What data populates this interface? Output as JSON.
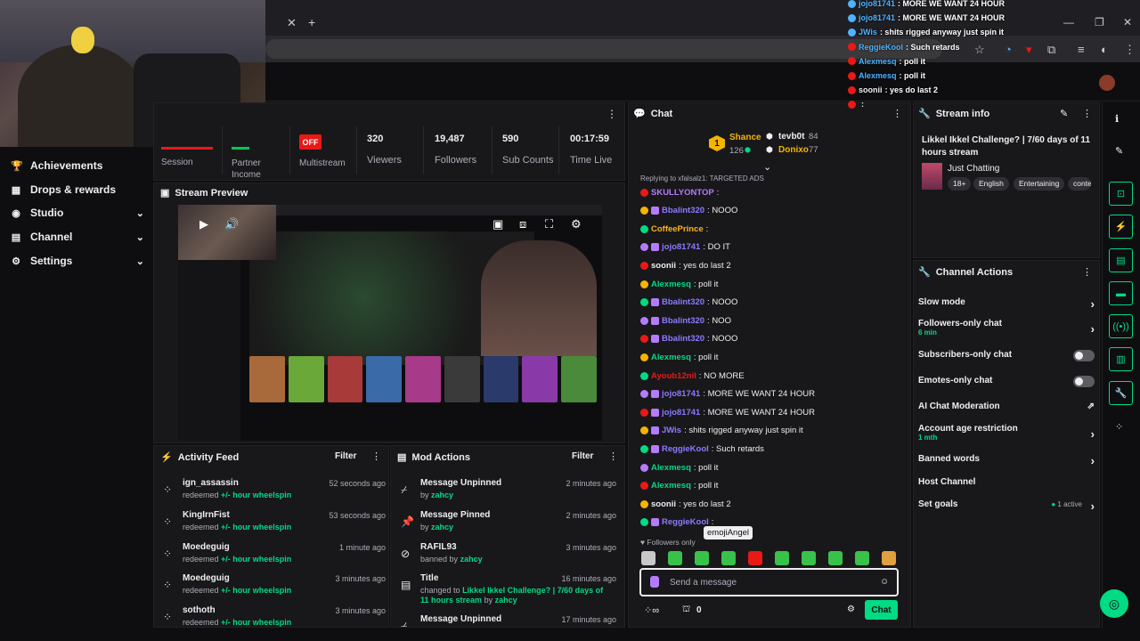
{
  "browser": {
    "tab_close": "✕",
    "tab_new": "+",
    "window_controls": [
      "—",
      "❐",
      "✕"
    ]
  },
  "nav": {
    "items": [
      {
        "label": "Achievements",
        "icon": "trophy-icon",
        "glyph": "🏆",
        "chevron": false
      },
      {
        "label": "Drops & rewards",
        "icon": "gift-icon",
        "glyph": "🎁",
        "chevron": false
      },
      {
        "label": "Studio",
        "icon": "studio-icon",
        "glyph": "◉",
        "chevron": true
      },
      {
        "label": "Channel",
        "icon": "channel-icon",
        "glyph": "🗂",
        "chevron": true
      },
      {
        "label": "Settings",
        "icon": "gear-icon",
        "glyph": "⚙",
        "chevron": true
      }
    ]
  },
  "stats": {
    "session_label": "Session",
    "partner_label": "Partner\nIncome",
    "multistream_label": "Multistream",
    "off_badge": "OFF",
    "viewers_value": "320",
    "viewers_label": "Viewers",
    "followers_value": "19,487",
    "followers_label": "Followers",
    "subs_value": "590",
    "subs_label": "Sub Counts",
    "time_value": "00:17:59",
    "time_label": "Time Live"
  },
  "preview": {
    "title": "Stream Preview"
  },
  "activity": {
    "title": "Activity Feed",
    "filter": "Filter",
    "rows": [
      {
        "name": "ign_assassin",
        "action": "redeemed",
        "reward": "+/- hour wheelspin",
        "time": "52 seconds ago"
      },
      {
        "name": "KingIrnFist",
        "action": "redeemed",
        "reward": "+/- hour wheelspin",
        "time": "53 seconds ago"
      },
      {
        "name": "Moedeguig",
        "action": "redeemed",
        "reward": "+/- hour wheelspin",
        "time": "1 minute ago"
      },
      {
        "name": "Moedeguig",
        "action": "redeemed",
        "reward": "+/- hour wheelspin",
        "time": "3 minutes ago"
      },
      {
        "name": "sothoth",
        "action": "redeemed",
        "reward": "+/- hour wheelspin",
        "time": "3 minutes ago"
      }
    ]
  },
  "mod": {
    "title": "Mod Actions",
    "filter": "Filter",
    "rows": [
      {
        "title": "Message Unpinned",
        "by": "by",
        "user": "zahcy",
        "time": "2 minutes ago"
      },
      {
        "title": "Message Pinned",
        "by": "by",
        "user": "zahcy",
        "time": "2 minutes ago"
      },
      {
        "title": "RAFIL93",
        "by": "banned by",
        "user": "zahcy",
        "time": "3 minutes ago"
      },
      {
        "title": "Title",
        "by": "changed to",
        "user": "Likkel Ikkel Challenge? | 7/60 days of 11 hours stream",
        "by2": "by",
        "user2": "zahcy",
        "time": "16 minutes ago"
      },
      {
        "title": "Message Unpinned",
        "by": "",
        "user": "",
        "time": "17 minutes ago"
      }
    ]
  },
  "chat": {
    "title": "Chat",
    "leaderboard": [
      {
        "name": "Shance",
        "score": "126"
      },
      {
        "name": "tevb0t",
        "score": "84"
      },
      {
        "name": "Donixo",
        "score": "77"
      }
    ],
    "rank": "1",
    "reply_note": "Replying to xfalsalz1: TARGETED ADS",
    "messages": [
      {
        "user": "SKULLYONTOP",
        "text": ":",
        "color": "#b57bff"
      },
      {
        "user": "Bbalint320",
        "text": ": NOOO",
        "color": "#8a7bff"
      },
      {
        "user": "CoffeePrince",
        "text": ":",
        "color": "#ffb31a"
      },
      {
        "user": "jojo81741",
        "text": ": DO IT",
        "color": "#8a7bff"
      },
      {
        "user": "soonii",
        "text": ": yes do last 2",
        "color": "#efeff1"
      },
      {
        "user": "Alexmesq",
        "text": ": poll it",
        "color": "#00db84"
      },
      {
        "user": "Bbalint320",
        "text": ": NOOO",
        "color": "#8a7bff"
      },
      {
        "user": "Bbalint320",
        "text": ": NOO",
        "color": "#8a7bff"
      },
      {
        "user": "Bbalint320",
        "text": ": NOOO",
        "color": "#8a7bff"
      },
      {
        "user": "Alexmesq",
        "text": ": poll it",
        "color": "#00db84"
      },
      {
        "user": "Ayoub12nil",
        "text": ": NO MORE",
        "color": "#e91916"
      },
      {
        "user": "jojo81741",
        "text": ": MORE WE WANT 24 HOUR",
        "color": "#8a7bff"
      },
      {
        "user": "jojo81741",
        "text": ": MORE WE WANT 24 HOUR",
        "color": "#8a7bff"
      },
      {
        "user": "JWis",
        "text": ": shits rigged anyway just spin it",
        "color": "#8a7bff"
      },
      {
        "user": "ReggieKool",
        "text": ": Such retards",
        "color": "#8a7bff"
      },
      {
        "user": "Alexmesq",
        "text": ": poll it",
        "color": "#00db84"
      },
      {
        "user": "Alexmesq",
        "text": ": poll it",
        "color": "#00db84"
      },
      {
        "user": "soonii",
        "text": ": yes do last 2",
        "color": "#efeff1"
      },
      {
        "user": "ReggieKool",
        "text": ":",
        "color": "#8a7bff"
      }
    ],
    "followers_only": "Followers only",
    "tooltip": "emojiAngel",
    "placeholder": "Send a message",
    "points": "0",
    "send": "Chat"
  },
  "overlay_chat": [
    {
      "user": "jojo81741",
      "text": ": MORE WE WANT 24 HOUR",
      "color": "#4fb3ff"
    },
    {
      "user": "jojo81741",
      "text": ": MORE WE WANT 24 HOUR",
      "color": "#4fb3ff"
    },
    {
      "user": "JWis",
      "text": ": shits rigged anyway just spin it",
      "color": "#4fb3ff"
    },
    {
      "user": "ReggieKool",
      "text": ": Such retards",
      "color": "#4fb3ff"
    },
    {
      "user": "Alexmesq",
      "text": ": poll it",
      "color": "#4fb3ff"
    },
    {
      "user": "Alexmesq",
      "text": ": poll it",
      "color": "#4fb3ff"
    },
    {
      "user": "soonii",
      "text": ": yes do last 2",
      "color": "#efeff1"
    },
    {
      "user": "",
      "text": ":",
      "color": "#4fb3ff"
    }
  ],
  "stream_info": {
    "title": "Stream info",
    "stream_title": "Likkel Ikkel Challenge? | 7/60 days of 11 hours stream",
    "category": "Just Chatting",
    "tags": [
      "18+",
      "English",
      "Entertaining",
      "conte"
    ]
  },
  "channel_actions": {
    "title": "Channel Actions",
    "rows": [
      {
        "label": "Slow mode",
        "kind": "chevron"
      },
      {
        "label": "Followers-only chat",
        "sub": "6 min",
        "kind": "chevron"
      },
      {
        "label": "Subscribers-only chat",
        "kind": "toggle"
      },
      {
        "label": "Emotes-only chat",
        "kind": "toggle"
      },
      {
        "label": "AI Chat Moderation",
        "kind": "external"
      },
      {
        "label": "Account age restriction",
        "sub": "1 mth",
        "kind": "chevron"
      },
      {
        "label": "Banned words",
        "kind": "chevron"
      },
      {
        "label": "Host Channel",
        "kind": "none"
      },
      {
        "label": "Set goals",
        "extra": "1 active",
        "kind": "chevron"
      }
    ]
  },
  "colors": {
    "accent": "#00db84",
    "live_red": "#e91916",
    "panel": "#18181b",
    "bg": "#0e0e10"
  }
}
